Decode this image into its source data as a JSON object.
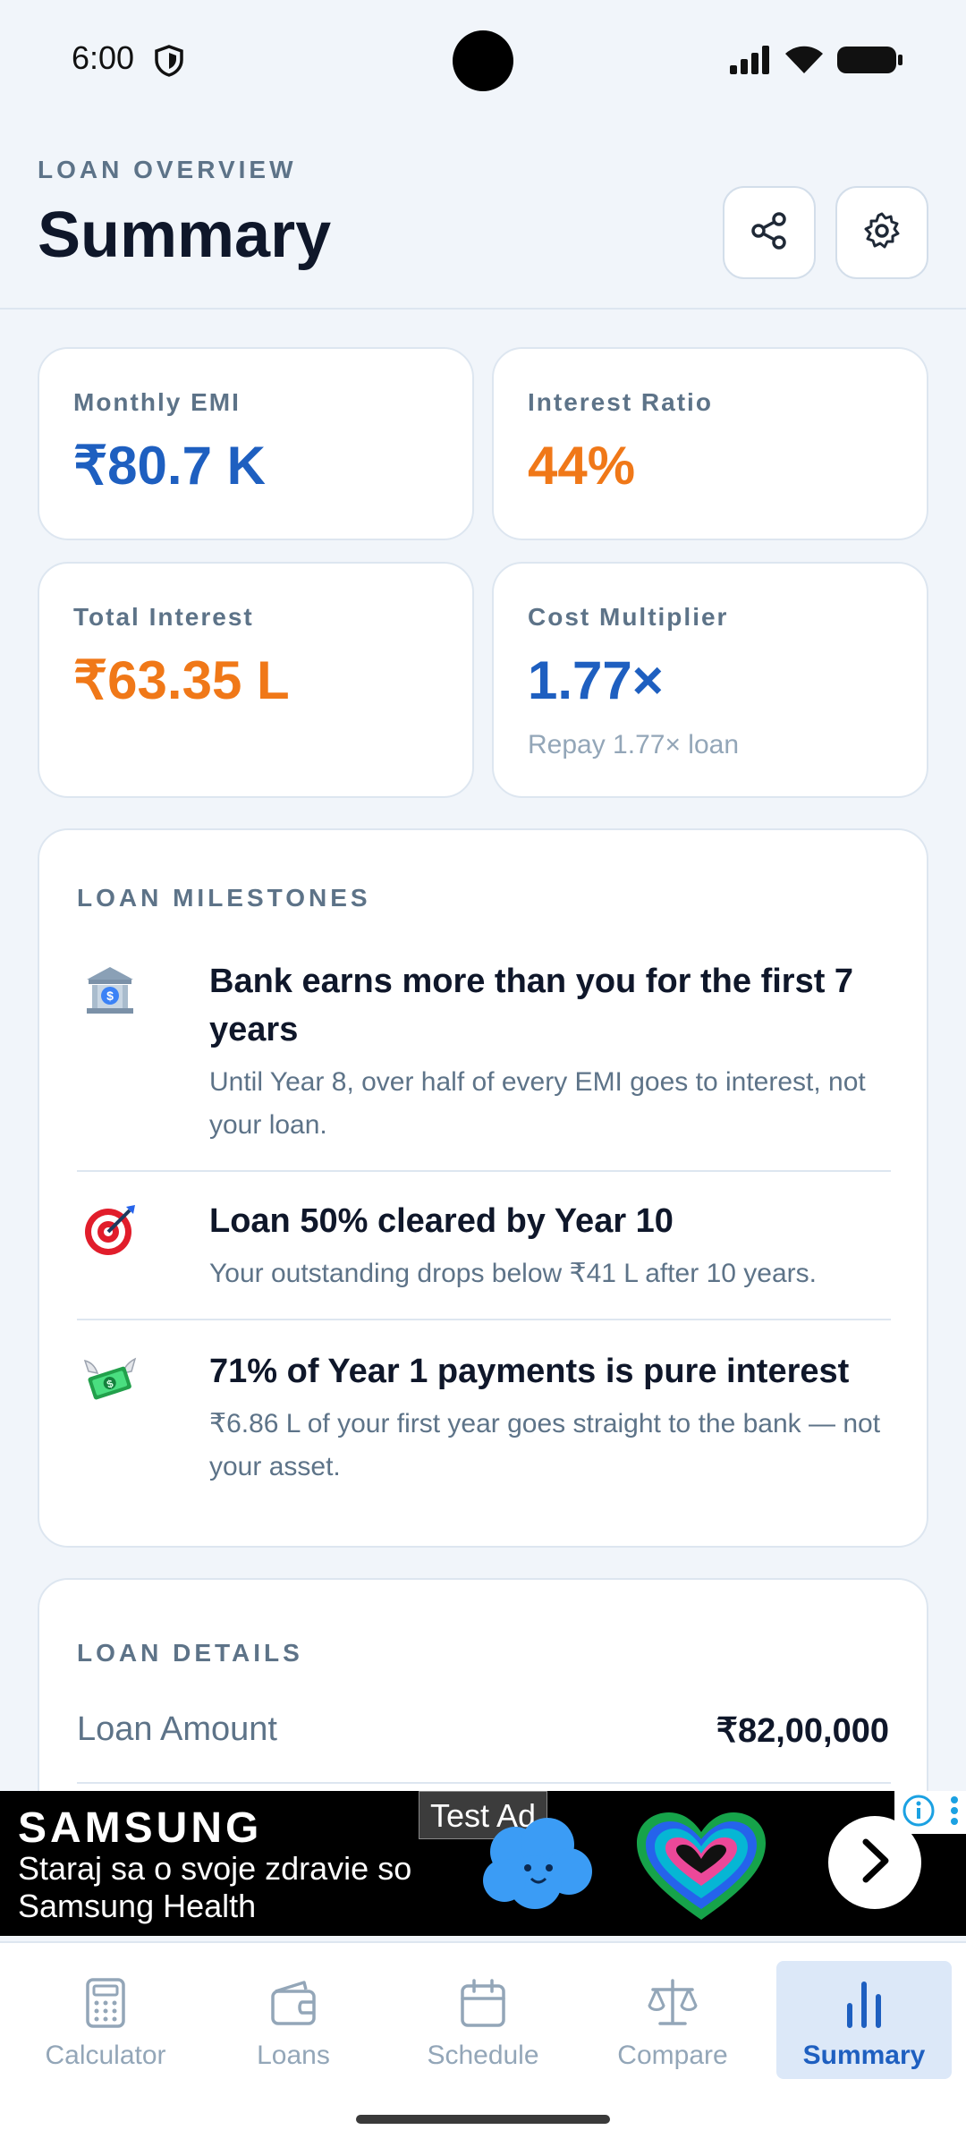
{
  "status": {
    "time": "6:00"
  },
  "header": {
    "overline": "LOAN OVERVIEW",
    "title": "Summary"
  },
  "stats": [
    {
      "label": "Monthly EMI",
      "value": "₹80.7 K",
      "color": "#1e5fc0"
    },
    {
      "label": "Interest Ratio",
      "value": "44%",
      "color": "#f07818"
    },
    {
      "label": "Total Interest",
      "value": "₹63.35 L",
      "color": "#f07818"
    },
    {
      "label": "Cost Multiplier",
      "value": "1.77×",
      "sub": "Repay 1.77× loan",
      "color": "#1e5fc0"
    }
  ],
  "milestones": {
    "title": "LOAN MILESTONES",
    "items": [
      {
        "icon": "bank-icon",
        "title": "Bank earns more than you for the first 7 years",
        "desc": "Until Year 8, over half of every EMI goes to interest, not your loan."
      },
      {
        "icon": "target-icon",
        "title": "Loan 50% cleared by Year 10",
        "desc": "Your outstanding drops below ₹41 L after 10 years."
      },
      {
        "icon": "money-wings-icon",
        "title": "71% of Year 1 payments is pure interest",
        "desc": "₹6.86 L of your first year goes straight to the bank — not your asset."
      }
    ]
  },
  "details": {
    "title": "LOAN DETAILS",
    "rows": [
      {
        "label": "Loan Amount",
        "value": "₹82,00,000"
      }
    ]
  },
  "ad": {
    "brand": "SAMSUNG",
    "text": "Staraj sa o svoje zdravie so Samsung Health",
    "tag": "Test Ad"
  },
  "nav": [
    {
      "label": "Calculator",
      "icon": "calculator-icon"
    },
    {
      "label": "Loans",
      "icon": "wallet-icon"
    },
    {
      "label": "Schedule",
      "icon": "calendar-icon"
    },
    {
      "label": "Compare",
      "icon": "scale-icon"
    },
    {
      "label": "Summary",
      "icon": "bar-chart-icon",
      "active": true
    }
  ],
  "colors": {
    "accent": "#1e5fc0",
    "warning": "#f07818",
    "muted": "#5d7388",
    "background": "#f1f5fa"
  }
}
